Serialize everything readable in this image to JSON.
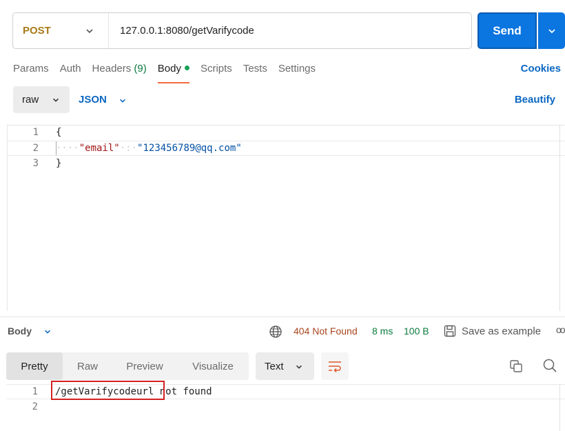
{
  "request": {
    "method": "POST",
    "url": "127.0.0.1:8080/getVarifycode",
    "send_label": "Send"
  },
  "tabs": [
    {
      "label": "Params"
    },
    {
      "label": "Auth"
    },
    {
      "label": "Headers",
      "count": "(9)"
    },
    {
      "label": "Body",
      "active": true
    },
    {
      "label": "Scripts"
    },
    {
      "label": "Tests"
    },
    {
      "label": "Settings"
    }
  ],
  "cookies_label": "Cookies",
  "body_mode": {
    "type": "raw",
    "format": "JSON",
    "beautify_label": "Beautify"
  },
  "editor": {
    "lines": [
      {
        "num": "1",
        "text": "{"
      },
      {
        "num": "2",
        "indent": "····",
        "key": "\"email\"",
        "sep": "·:·",
        "value": "\"123456789@qq.com\""
      },
      {
        "num": "3",
        "text": "}"
      }
    ]
  },
  "response": {
    "title": "Body",
    "status": "404 Not Found",
    "time": "8 ms",
    "size": "100 B",
    "save_label": "Save as example",
    "more_label": "oo",
    "view_tabs": [
      "Pretty",
      "Raw",
      "Preview",
      "Visualize"
    ],
    "text_format": "Text",
    "lines": [
      {
        "num": "1",
        "highlighted": "/getVarifycodeurl",
        "rest": " not found"
      },
      {
        "num": "2",
        "text": ""
      }
    ]
  },
  "icons": {
    "method_caret": "chevron-down-icon",
    "send_caret": "chevron-down-icon",
    "globe": "globe-icon",
    "save": "save-icon",
    "wrap": "wrap-lines-icon",
    "copy": "copy-icon",
    "search": "search-icon"
  },
  "colors": {
    "accent": "#0b75e0",
    "method": "#a97a15",
    "status_error": "#a9461f",
    "status_ok": "#0c7a3d",
    "active_tab_underline": "#f26b3a",
    "highlight_box": "#d32020"
  }
}
